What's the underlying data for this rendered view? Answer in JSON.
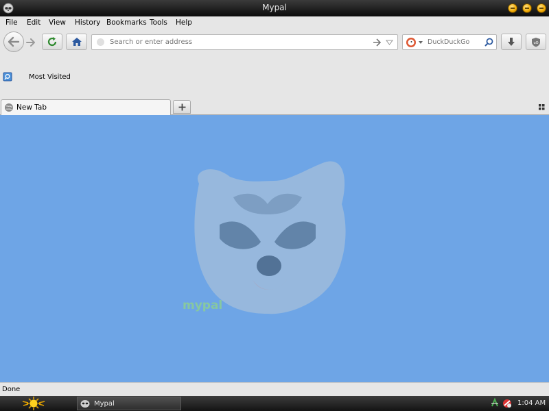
{
  "window": {
    "title": "Mypal"
  },
  "menu": [
    "File",
    "Edit",
    "View",
    "History",
    "Bookmarks",
    "Tools",
    "Help"
  ],
  "navbar": {
    "address_placeholder": "Search or enter address",
    "search_engine": "DuckDuckGo"
  },
  "bookmarks": {
    "most_visited": "Most Visited"
  },
  "tabs": [
    {
      "label": "New Tab"
    }
  ],
  "content": {
    "mascot_text": "mypal",
    "background_color": "#6ea5e6"
  },
  "status": {
    "text": "Done"
  },
  "taskbar": {
    "task_label": "Mypal",
    "clock": "1:04 AM"
  }
}
